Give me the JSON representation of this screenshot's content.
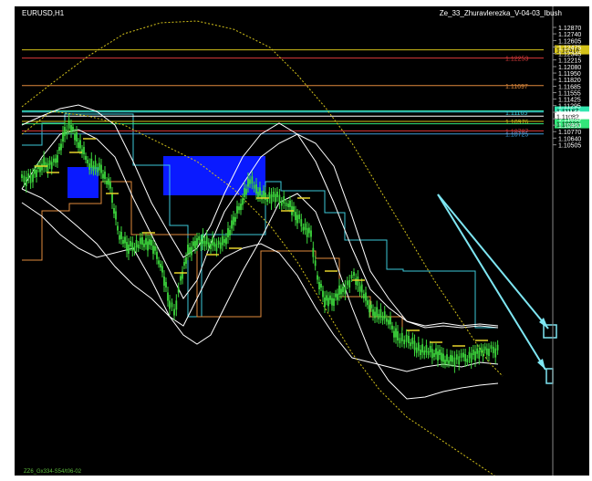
{
  "window": {
    "symbol": "EURUSD,H1",
    "indicator": "Ze_33_Zhuravlerezka_V-04-03_Ibush",
    "footer": "ZZ6_Gx334-S54/t06-02"
  },
  "colors": {
    "background": "#000000",
    "candles": "#3cd63c",
    "bands": "#ffffff",
    "dotted": "#d4c21a",
    "cyan": "#3cc8d8",
    "orange": "#e08a3c",
    "blue_box": "#0a1aff",
    "annotation": "#7ee6f2"
  },
  "price_axis": {
    "ticks": [
      "1.12870",
      "1.12740",
      "1.12605",
      "1.12475",
      "1.12345",
      "1.12215",
      "1.12080",
      "1.11950",
      "1.11820",
      "1.11685",
      "1.11555",
      "1.11425",
      "1.11295",
      "1.11160",
      "1.11030",
      "1.10900",
      "1.10770",
      "1.10640",
      "1.10505"
    ]
  },
  "levels": [
    {
      "label": "1.12418",
      "price": 1.12418,
      "color": "#d4c21a",
      "text_color": "#000000"
    },
    {
      "label": "1.12253",
      "price": 1.12253,
      "color": "#d93a3a",
      "text_color": "#d93a3a"
    },
    {
      "label": "1.11697",
      "price": 1.11697,
      "color": "#e08a3c",
      "text_color": "#e08a3c"
    },
    {
      "label": "1.11187",
      "price": 1.11187,
      "color": "#33e6b0",
      "text_color": "#000000"
    },
    {
      "label": "1.11165",
      "price": 1.11165,
      "color": "#3cc8d8",
      "text_color": "#3cc8d8"
    },
    {
      "label": "1.11082",
      "price": 1.11082,
      "color": "#ffffff",
      "text_color": "#000000"
    },
    {
      "label": "1.10976",
      "price": 1.10976,
      "color": "#d4c21a",
      "text_color": "#d4c21a"
    },
    {
      "label": "1.10929",
      "price": 1.10929,
      "color": "#33e67a",
      "text_color": "#000000"
    },
    {
      "label": "1.10787",
      "price": 1.10787,
      "color": "#d93a3a",
      "text_color": "#d93a3a"
    },
    {
      "label": "1.10725",
      "price": 1.10725,
      "color": "#3c9ad8",
      "text_color": "#3c9ad8"
    }
  ]
}
